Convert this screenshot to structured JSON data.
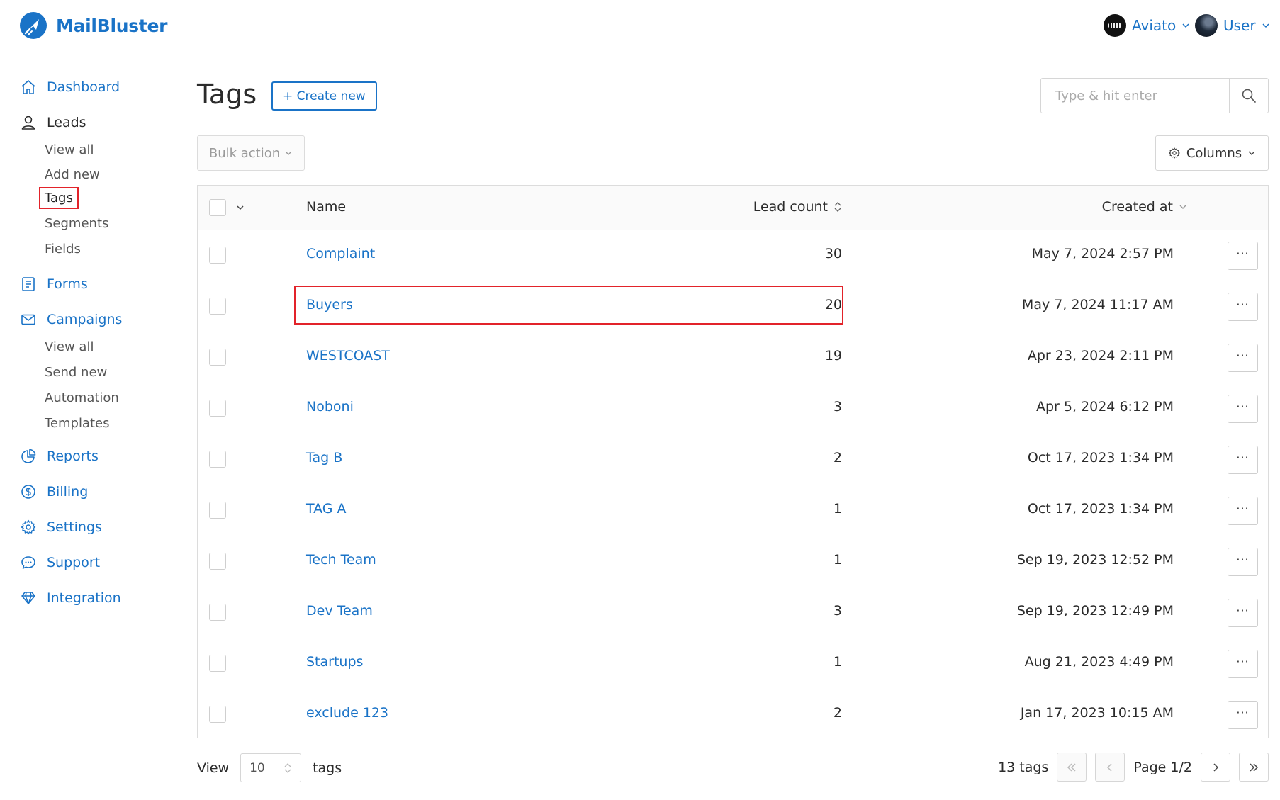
{
  "brand": {
    "name": "MailBluster"
  },
  "accounts": {
    "org": {
      "label": "Aviato"
    },
    "user": {
      "label": "User"
    }
  },
  "sidebar": {
    "dashboard": "Dashboard",
    "leads": "Leads",
    "leads_sub": [
      "View all",
      "Add new",
      "Tags",
      "Segments",
      "Fields"
    ],
    "forms": "Forms",
    "campaigns": "Campaigns",
    "campaigns_sub": [
      "View all",
      "Send new",
      "Automation",
      "Templates"
    ],
    "reports": "Reports",
    "billing": "Billing",
    "settings": "Settings",
    "support": "Support",
    "integration": "Integration"
  },
  "main": {
    "title": "Tags",
    "create_label": "+ Create new",
    "search_placeholder": "Type & hit enter",
    "bulk_label": "Bulk action",
    "columns_label": "Columns"
  },
  "table": {
    "headers": {
      "name": "Name",
      "count": "Lead count",
      "created": "Created at"
    },
    "rows": [
      {
        "name": "Complaint",
        "count": "30",
        "created": "May 7, 2024 2:57 PM"
      },
      {
        "name": "Buyers",
        "count": "20",
        "created": "May 7, 2024 11:17 AM"
      },
      {
        "name": "WESTCOAST",
        "count": "19",
        "created": "Apr 23, 2024 2:11 PM"
      },
      {
        "name": "Noboni",
        "count": "3",
        "created": "Apr 5, 2024 6:12 PM"
      },
      {
        "name": "Tag B",
        "count": "2",
        "created": "Oct 17, 2023 1:34 PM"
      },
      {
        "name": "TAG A",
        "count": "1",
        "created": "Oct 17, 2023 1:34 PM"
      },
      {
        "name": "Tech Team",
        "count": "1",
        "created": "Sep 19, 2023 12:52 PM"
      },
      {
        "name": "Dev Team",
        "count": "3",
        "created": "Sep 19, 2023 12:49 PM"
      },
      {
        "name": "Startups",
        "count": "1",
        "created": "Aug 21, 2023 4:49 PM"
      },
      {
        "name": "exclude 123",
        "count": "2",
        "created": "Jan 17, 2023 10:15 AM"
      }
    ],
    "row_menu_label": "···"
  },
  "footer": {
    "view_label": "View",
    "page_size": "10",
    "unit_label": "tags",
    "total": "13 tags",
    "page": "Page 1/2"
  },
  "colors": {
    "accent": "#1a73c7",
    "highlight": "#e2232a"
  }
}
